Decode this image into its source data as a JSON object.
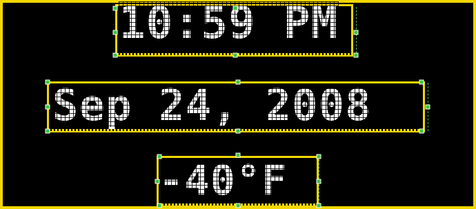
{
  "display": {
    "time": "10:59 PM",
    "date": "Sep 24, 2008",
    "temperature": "-40°F"
  },
  "colors": {
    "background": "#000000",
    "selection": "#f2d700",
    "handle": "#3cc43c",
    "text": "#ffffff"
  },
  "icons": {
    "resize_handle": "green-square-handle"
  }
}
